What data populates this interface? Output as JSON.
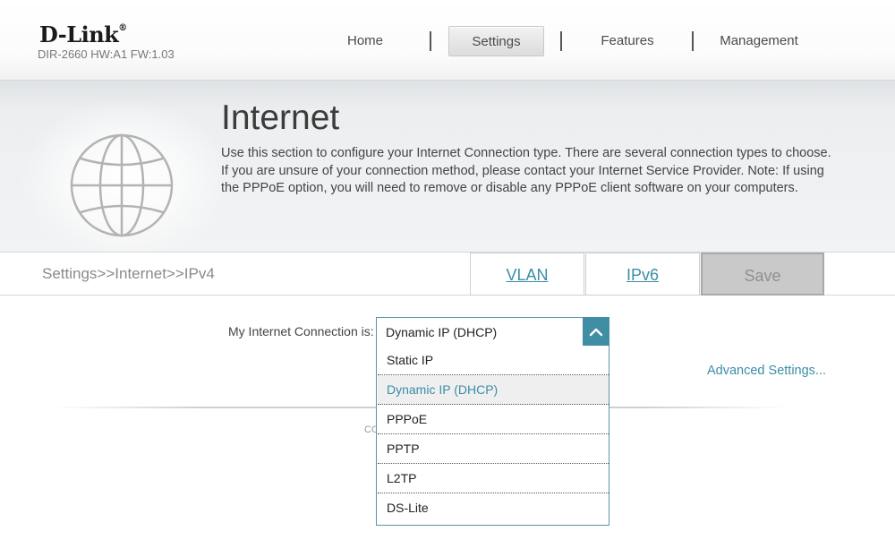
{
  "header": {
    "brand": "D-Link",
    "brand_mark": "®",
    "model_info": "DIR-2660 HW:A1 FW:1.03",
    "nav": [
      {
        "label": "Home"
      },
      {
        "label": "Settings",
        "active": true
      },
      {
        "label": "Features"
      },
      {
        "label": "Management"
      }
    ]
  },
  "banner": {
    "icon": "globe-icon",
    "title": "Internet",
    "description": "Use this section to configure your Internet Connection type. There are several connection types to choose. If you are unsure of your connection method, please contact your Internet Service Provider. Note: If using the PPPoE option, you will need to remove or disable any PPPoE client software on your computers."
  },
  "breadcrumb": "Settings>>Internet>>IPv4",
  "tabs": {
    "vlan": "VLAN",
    "ipv6": "IPv6",
    "save": "Save"
  },
  "form": {
    "connection_label": "My Internet Connection is:",
    "connection_value": "Dynamic IP (DHCP)",
    "options": [
      "Static IP",
      "Dynamic IP (DHCP)",
      "PPPoE",
      "PPTP",
      "L2TP",
      "DS-Lite"
    ],
    "selected_index": 1,
    "advanced_link": "Advanced Settings...",
    "footer_fragment": "CO"
  },
  "colors": {
    "accent": "#3a8ea6",
    "save_bg": "#c9c9c9"
  }
}
